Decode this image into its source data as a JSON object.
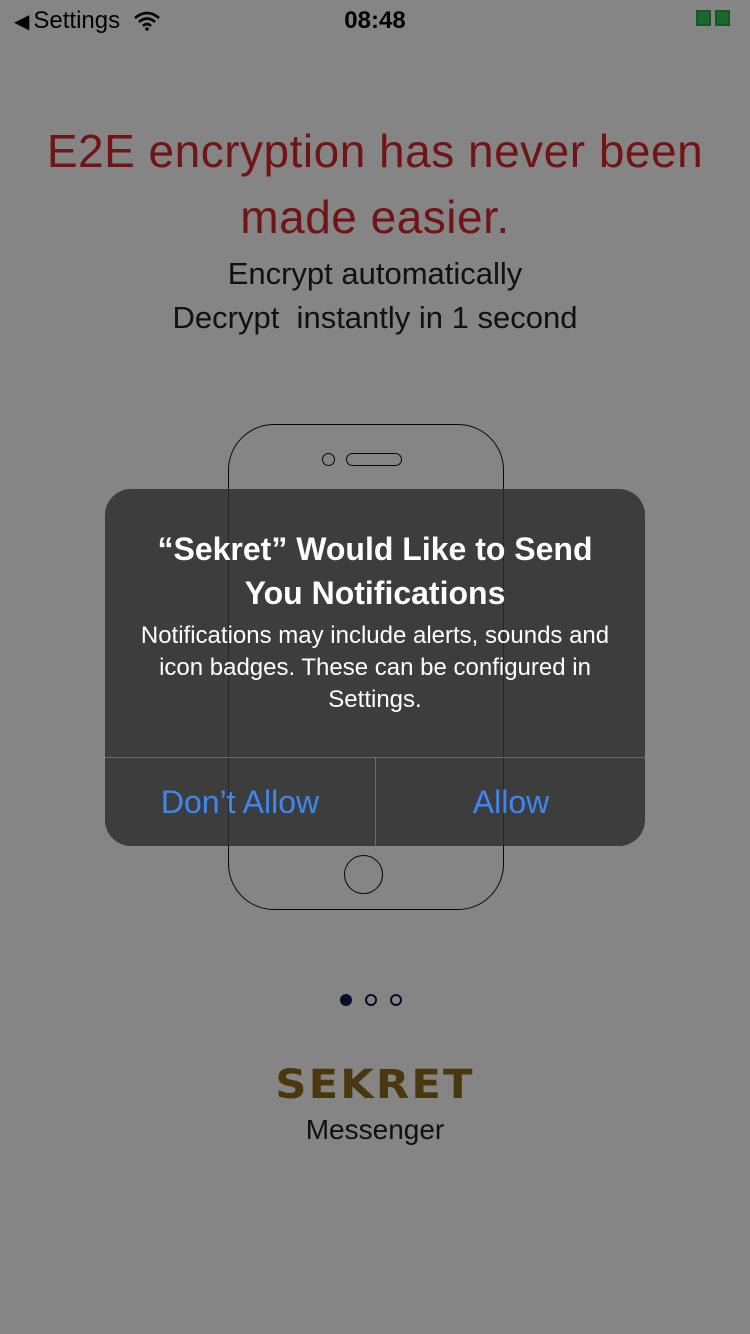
{
  "status_bar": {
    "back_label": "Settings",
    "time": "08:48"
  },
  "onboarding": {
    "headline": "E2E encryption has never been made easier.",
    "subtitle": "Encrypt automatically\nDecrypt  instantly in 1 second",
    "brand": "SEKRET",
    "tagline": "Messenger",
    "page_dots": 3,
    "active_page": 1
  },
  "alert": {
    "title": "“Sekret” Would Like to Send You Notifications",
    "message": "Notifications may include alerts, sounds and icon badges. These can be configured in Settings.",
    "dont_allow_label": "Don’t Allow",
    "allow_label": "Allow"
  },
  "colors": {
    "headline": "#d7282b",
    "alert_button": "#3f87f0",
    "brand": "#8c6a1c",
    "battery": "#32c759",
    "page_dot": "#0b1b4c"
  },
  "icons": {
    "back": "chevron-left-icon",
    "wifi": "wifi-icon",
    "battery": "battery-icon"
  }
}
